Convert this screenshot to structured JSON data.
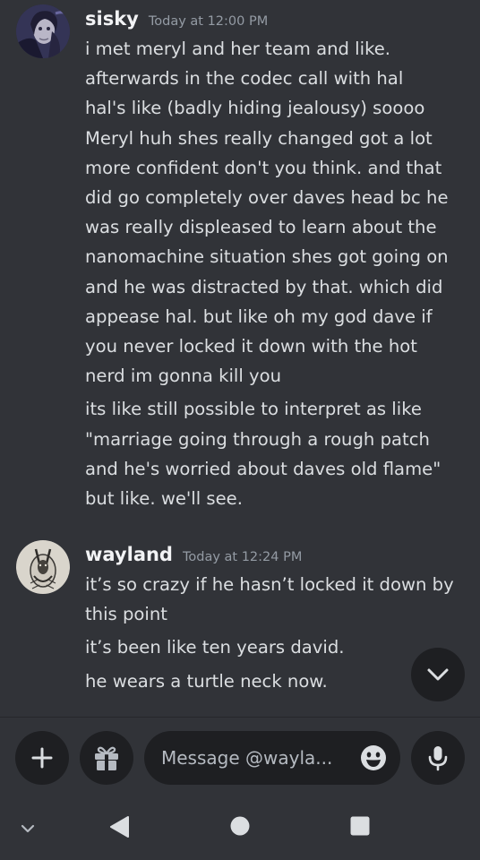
{
  "messages": [
    {
      "username": "sisky",
      "timestamp": "Today at 12:00 PM",
      "paragraphs": [
        "i met meryl and her team and like.\nafterwards in the codec call with hal\nhal's like (badly hiding jealousy) soooo\nMeryl huh shes really changed got a lot\nmore confident don't you think. and that\ndid go completely over daves head bc he\nwas really displeased to learn about the\nnanomachine situation shes got going on\nand he was distracted by that. which did\nappease hal. but like oh my god dave if\nyou never locked it down with the hot\nnerd im gonna kill you",
        "its like still possible to interpret as like\n\"marriage going through a rough patch\nand he's worried about daves old flame\"\nbut like. we'll see."
      ]
    },
    {
      "username": "wayland",
      "timestamp": "Today at 12:24 PM",
      "paragraphs": [
        "it’s so crazy if he hasn’t locked it down by\nthis point",
        "it’s been like ten years david.",
        "he wears a turtle neck now."
      ]
    }
  ],
  "composer": {
    "placeholder": "Message @wayla..."
  },
  "icons": {
    "scroll": "chevron-down-icon",
    "add": "plus-icon",
    "gift": "gift-icon",
    "emoji": "emoji-icon",
    "mic": "microphone-icon",
    "nav": [
      "chevron-down-icon",
      "back-triangle-icon",
      "home-circle-icon",
      "recents-square-icon"
    ]
  },
  "colors": {
    "background": "#313338",
    "input_background": "#1e1f22",
    "username": "#f2f3f5",
    "timestamp": "#949ba4",
    "text": "#dbdee1"
  }
}
